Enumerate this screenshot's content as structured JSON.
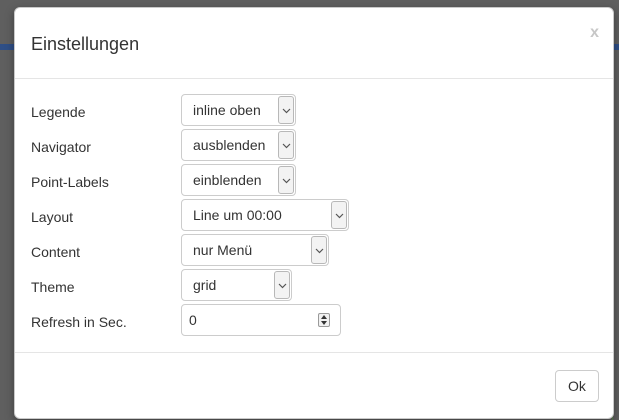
{
  "dialog": {
    "title": "Einstellungen",
    "close_label": "x",
    "ok_label": "Ok"
  },
  "settings": [
    {
      "label": "Legende",
      "value": "inline oben",
      "type": "select"
    },
    {
      "label": "Navigator",
      "value": "ausblenden",
      "type": "select"
    },
    {
      "label": "Point-Labels",
      "value": "einblenden",
      "type": "select"
    },
    {
      "label": "Layout",
      "value": "Line um 00:00",
      "type": "select"
    },
    {
      "label": "Content",
      "value": "nur Menü",
      "type": "select"
    },
    {
      "label": "Theme",
      "value": "grid",
      "type": "select"
    },
    {
      "label": "Refresh in Sec.",
      "value": "0",
      "type": "number"
    }
  ]
}
